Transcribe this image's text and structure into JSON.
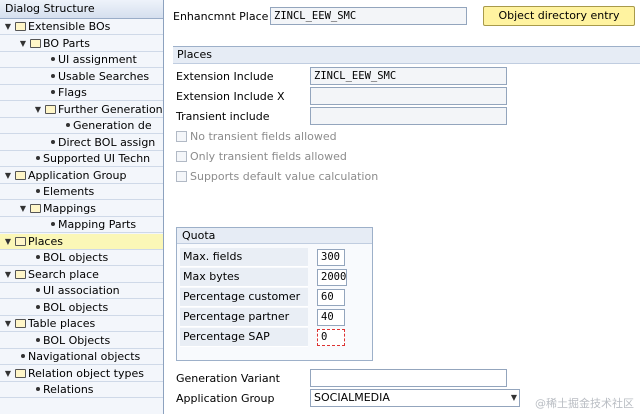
{
  "tree": {
    "header": "Dialog Structure",
    "nodes": [
      {
        "label": "Extensible BOs",
        "level": 0,
        "kind": "folder",
        "expanded": true
      },
      {
        "label": "BO Parts",
        "level": 1,
        "kind": "folder",
        "expanded": true
      },
      {
        "label": "UI assignment",
        "level": 2,
        "kind": "leaf"
      },
      {
        "label": "Usable Searches",
        "level": 2,
        "kind": "leaf"
      },
      {
        "label": "Flags",
        "level": 2,
        "kind": "leaf"
      },
      {
        "label": "Further Generation",
        "level": 2,
        "kind": "folder",
        "expanded": true
      },
      {
        "label": "Generation de",
        "level": 3,
        "kind": "leaf"
      },
      {
        "label": "Direct BOL assign",
        "level": 2,
        "kind": "leaf"
      },
      {
        "label": "Supported UI Techn",
        "level": 1,
        "kind": "leaf"
      },
      {
        "label": "Application Group",
        "level": 0,
        "kind": "folder",
        "expanded": true
      },
      {
        "label": "Elements",
        "level": 1,
        "kind": "leaf"
      },
      {
        "label": "Mappings",
        "level": 1,
        "kind": "folder",
        "expanded": true
      },
      {
        "label": "Mapping Parts",
        "level": 2,
        "kind": "leaf"
      },
      {
        "label": "Places",
        "level": 0,
        "kind": "folder",
        "expanded": true,
        "selected": true
      },
      {
        "label": "BOL objects",
        "level": 1,
        "kind": "leaf"
      },
      {
        "label": "Search place",
        "level": 0,
        "kind": "folder",
        "expanded": true
      },
      {
        "label": "UI association",
        "level": 1,
        "kind": "leaf"
      },
      {
        "label": "BOL objects",
        "level": 1,
        "kind": "leaf"
      },
      {
        "label": "Table places",
        "level": 0,
        "kind": "folder",
        "expanded": true
      },
      {
        "label": "BOL Objects",
        "level": 1,
        "kind": "leaf"
      },
      {
        "label": "Navigational objects",
        "level": 0,
        "kind": "leaf"
      },
      {
        "label": "Relation object types",
        "level": 0,
        "kind": "folder",
        "expanded": true
      },
      {
        "label": "Relations",
        "level": 1,
        "kind": "leaf"
      }
    ]
  },
  "header": {
    "place_label": "Enhancmnt Place",
    "place_value": "ZINCL_EEW_SMC",
    "object_dir_button": "Object directory entry"
  },
  "places": {
    "title": "Places",
    "ext_include_label": "Extension Include",
    "ext_include_value": "ZINCL_EEW_SMC",
    "ext_include_x_label": "Extension Include X",
    "ext_include_x_value": "",
    "transient_label": "Transient include",
    "transient_value": "",
    "checkboxes": [
      {
        "label": "No transient fields allowed",
        "checked": false
      },
      {
        "label": "Only transient fields allowed",
        "checked": false
      },
      {
        "label": "Supports default value calculation",
        "checked": false
      }
    ]
  },
  "quota": {
    "title": "Quota",
    "rows": [
      {
        "label": "Max. fields",
        "value": "300"
      },
      {
        "label": "Max bytes",
        "value": "2000"
      },
      {
        "label": "Percentage customer",
        "value": "60"
      },
      {
        "label": "Percentage partner",
        "value": "40"
      },
      {
        "label": "Percentage SAP",
        "value": "0"
      }
    ]
  },
  "footer": {
    "gen_variant_label": "Generation Variant",
    "gen_variant_value": "",
    "app_group_label": "Application Group",
    "app_group_value": "SOCIALMEDIA"
  },
  "watermark": "@稀土掘金技术社区"
}
